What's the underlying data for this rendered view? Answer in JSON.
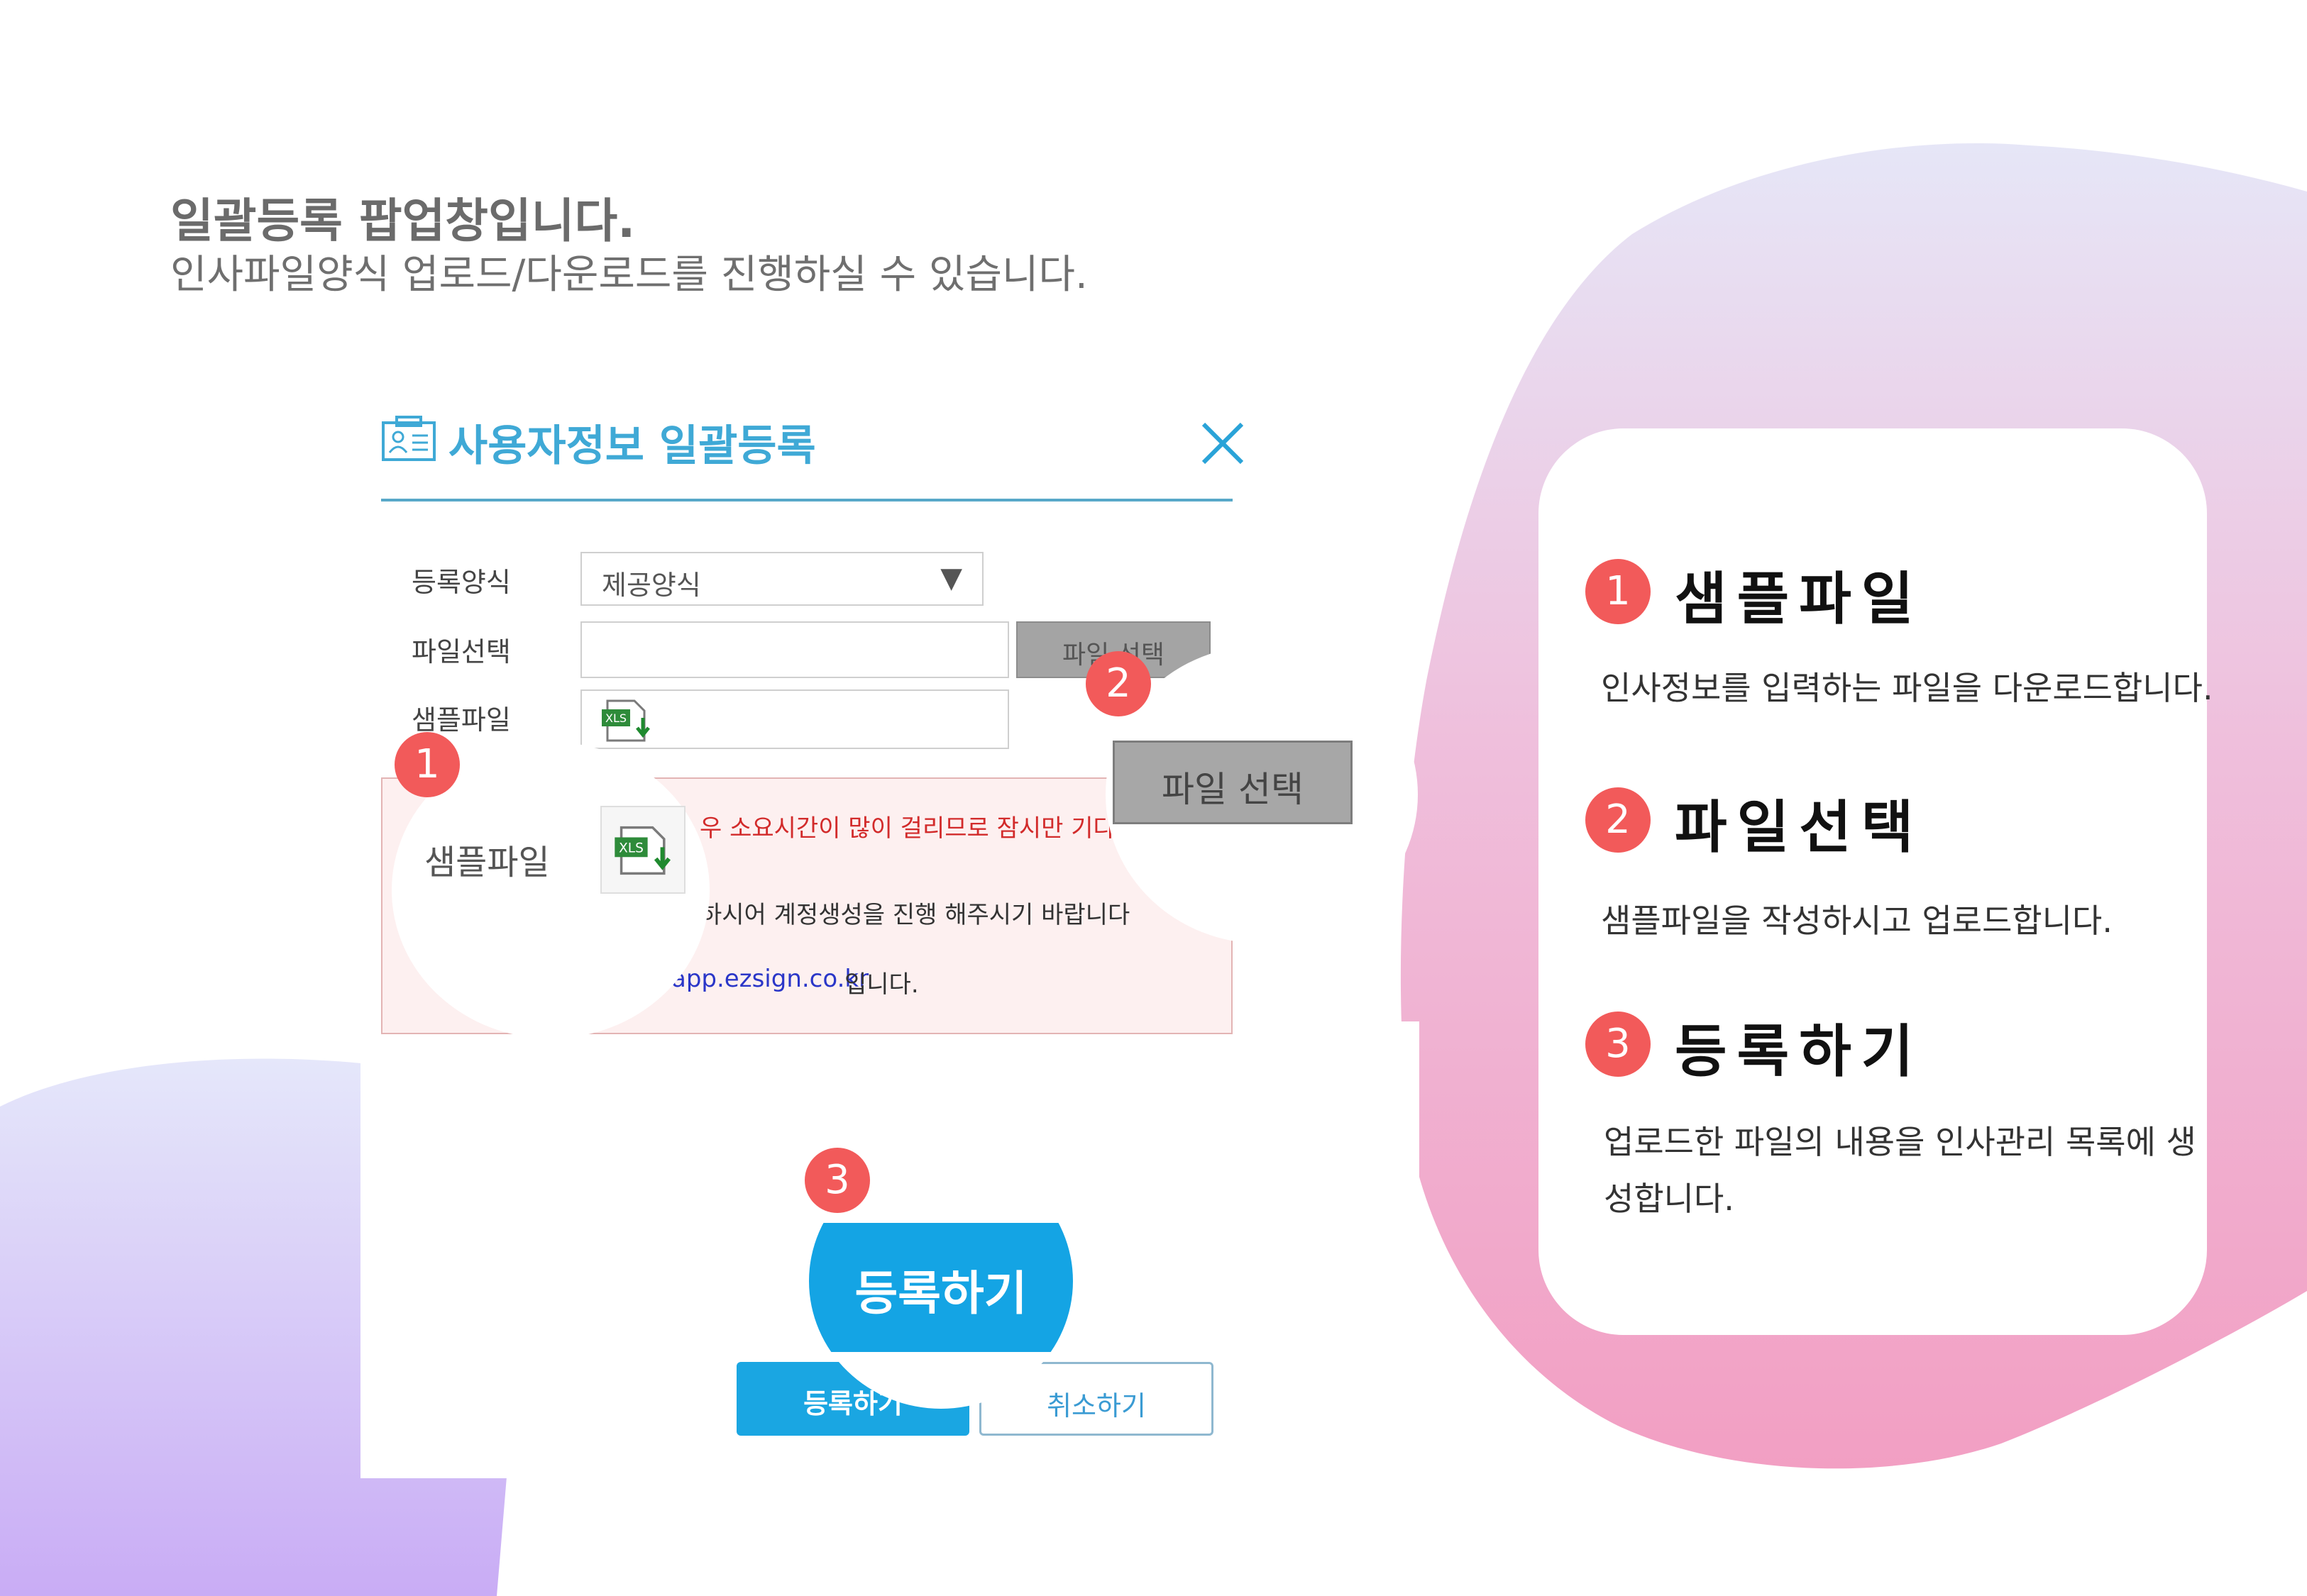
{
  "intro": {
    "heading": "일괄등록 팝업창입니다.",
    "subheading": "인사파일양식 업로드/다운로드를 진행하실 수 있습니다."
  },
  "popup": {
    "title": "사용자정보 일괄등록",
    "labels": {
      "format": "등록양식",
      "file_select": "파일선택",
      "sample_file": "샘플파일"
    },
    "format_select": {
      "value": "제공양식",
      "arrow": "▼"
    },
    "file_select_button": "파일 선택",
    "notice_lines": [
      "…우 소요시간이 많이 걸리므로 잠시만 기다",
      "…하시어 계정생성을 진행 해주시기 바랍니다",
      "app.ezsign.co.kr입니다."
    ],
    "notice_link": "app.ezsign.co.kr",
    "notice_suffix": "입니다.",
    "xls_text": "XLS",
    "register_button": "등록하기",
    "cancel_button": "취소하기"
  },
  "zoom": {
    "sample_label": "샘플파일",
    "file_select_button": "파일 선택",
    "register_button": "등록하기"
  },
  "badges": [
    "1",
    "2",
    "3"
  ],
  "steps": [
    {
      "num": "1",
      "title": "샘플파일",
      "desc": "인사정보를 입력하는 파일을 다운로드합니다."
    },
    {
      "num": "2",
      "title": "파일선택",
      "desc": "샘플파일을 작성하시고 업로드합니다."
    },
    {
      "num": "3",
      "title": "등록하기",
      "desc_line1": "업로드한 파일의 내용을 인사관리 목록에 생",
      "desc_line2": "성합니다."
    }
  ],
  "colors": {
    "accent_blue": "#1aa6e2",
    "title_blue": "#3fa9d6",
    "badge_red": "#f25a5a",
    "notice_red": "#d22b2b",
    "link_blue": "#2a36c8"
  },
  "icons": {
    "popup_icon": "user-card-icon",
    "close": "close-icon",
    "sample": "xls-download-icon"
  }
}
